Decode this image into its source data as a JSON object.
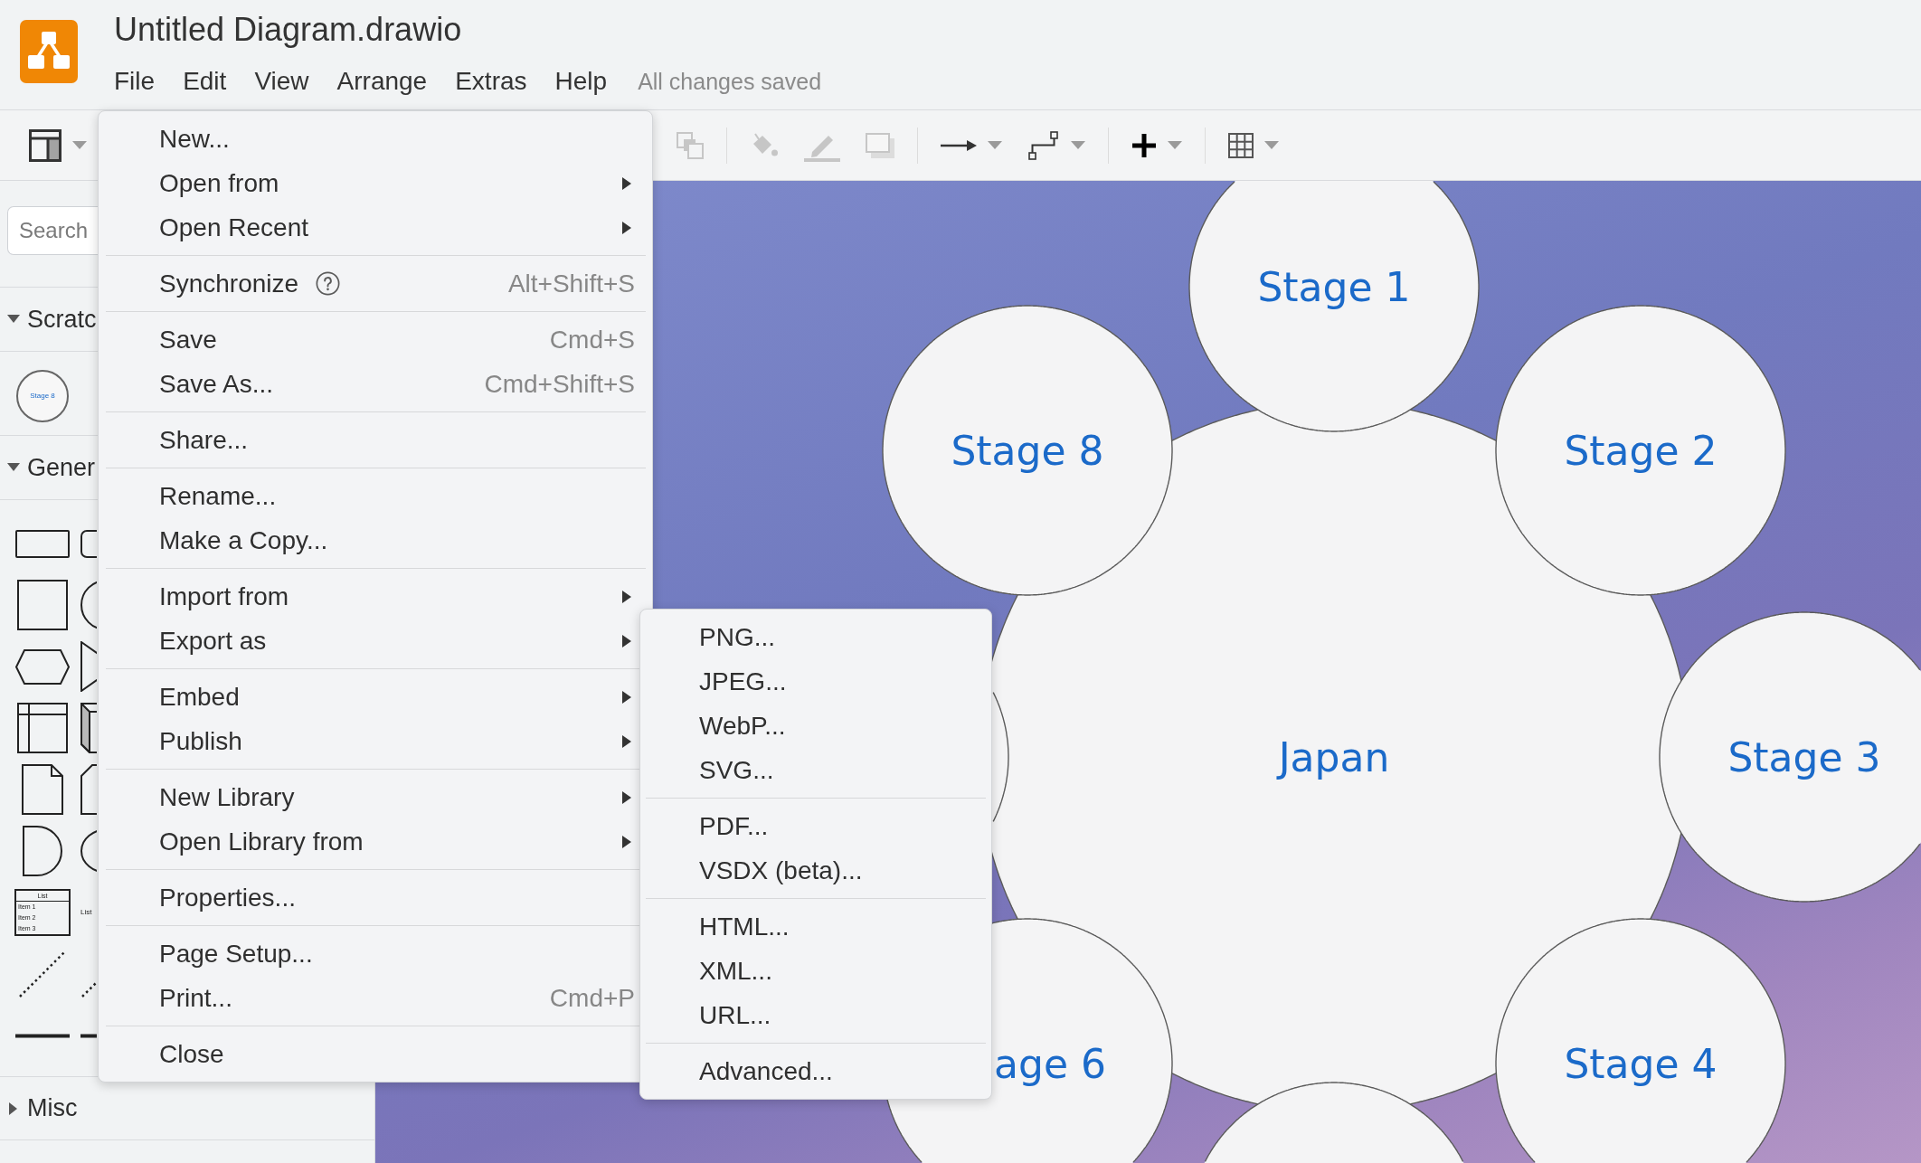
{
  "app": {
    "title": "Untitled Diagram.drawio",
    "status": "All changes saved"
  },
  "menubar": [
    "File",
    "Edit",
    "View",
    "Arrange",
    "Extras",
    "Help"
  ],
  "toolbar": {
    "left": [
      {
        "kind": "format",
        "disabled": false,
        "dropdown": true
      }
    ],
    "groups": [
      [
        {
          "kind": "arrange",
          "disabled": true
        }
      ],
      [
        {
          "kind": "fill",
          "disabled": true
        },
        {
          "kind": "line",
          "disabled": true
        },
        {
          "kind": "shadow",
          "disabled": true
        }
      ],
      [
        {
          "kind": "connection",
          "disabled": false,
          "dropdown": true
        },
        {
          "kind": "waypoint",
          "disabled": false,
          "dropdown": true
        }
      ],
      [
        {
          "kind": "insert",
          "disabled": false,
          "dropdown": true
        }
      ],
      [
        {
          "kind": "table",
          "disabled": false,
          "dropdown": true
        }
      ]
    ]
  },
  "sidebar": {
    "search": {
      "placeholder": "Search"
    },
    "sections": [
      {
        "title": "Scratc",
        "expanded": true,
        "shapes": [
          {
            "kind": "circle",
            "label": "Stage 8"
          }
        ]
      },
      {
        "title": "Gener",
        "expanded": true,
        "shapes": [
          {
            "kind": "rectangle"
          },
          {
            "kind": "rounded-rectangle"
          },
          {
            "kind": "square"
          },
          {
            "kind": "circle"
          },
          {
            "kind": "hexagon"
          },
          {
            "kind": "triangle"
          },
          {
            "kind": "storage"
          },
          {
            "kind": "cube"
          },
          {
            "kind": "document"
          },
          {
            "kind": "card"
          },
          {
            "kind": "half-round"
          },
          {
            "kind": "ellipse"
          },
          {
            "kind": "list",
            "title": "List",
            "rows": [
              "Item 1",
              "Item 2",
              "Item 3"
            ]
          },
          {
            "kind": "text",
            "label": "List"
          },
          {
            "kind": "dotted-line"
          },
          {
            "kind": "dotted-line"
          },
          {
            "kind": "line"
          },
          {
            "kind": "line"
          }
        ]
      },
      {
        "title": "Misc",
        "expanded": false
      }
    ]
  },
  "file_menu": {
    "groups": [
      [
        {
          "label": "New...",
          "submenu": false
        },
        {
          "label": "Open from",
          "submenu": true
        },
        {
          "label": "Open Recent",
          "submenu": true
        }
      ],
      [
        {
          "label": "Synchronize",
          "submenu": false,
          "help": true,
          "shortcut": "Alt+Shift+S"
        }
      ],
      [
        {
          "label": "Save",
          "submenu": false,
          "shortcut": "Cmd+S"
        },
        {
          "label": "Save As...",
          "submenu": false,
          "shortcut": "Cmd+Shift+S"
        }
      ],
      [
        {
          "label": "Share...",
          "submenu": false
        }
      ],
      [
        {
          "label": "Rename...",
          "submenu": false
        },
        {
          "label": "Make a Copy...",
          "submenu": false
        }
      ],
      [
        {
          "label": "Import from",
          "submenu": true
        },
        {
          "label": "Export as",
          "submenu": true
        }
      ],
      [
        {
          "label": "Embed",
          "submenu": true
        },
        {
          "label": "Publish",
          "submenu": true
        }
      ],
      [
        {
          "label": "New Library",
          "submenu": true
        },
        {
          "label": "Open Library from",
          "submenu": true
        }
      ],
      [
        {
          "label": "Properties...",
          "submenu": false
        }
      ],
      [
        {
          "label": "Page Setup...",
          "submenu": false
        },
        {
          "label": "Print...",
          "submenu": false,
          "shortcut": "Cmd+P"
        }
      ],
      [
        {
          "label": "Close",
          "submenu": false
        }
      ]
    ]
  },
  "export_submenu": {
    "groups": [
      [
        "PNG...",
        "JPEG...",
        "WebP...",
        "SVG..."
      ],
      [
        "PDF...",
        "VSDX (beta)..."
      ],
      [
        "HTML...",
        "XML...",
        "URL..."
      ],
      [
        "Advanced..."
      ]
    ]
  },
  "diagram": {
    "hub": {
      "kind": "circle",
      "label": "Japan"
    },
    "nodes": [
      {
        "kind": "circle",
        "label": "Stage 1"
      },
      {
        "kind": "circle",
        "label": "Stage 2"
      },
      {
        "kind": "circle",
        "label": "Stage 3"
      },
      {
        "kind": "circle",
        "label": "Stage 4"
      },
      {
        "kind": "circle"
      },
      {
        "kind": "circle",
        "label": "age 6"
      },
      {
        "kind": "circle"
      },
      {
        "kind": "circle",
        "label": "Stage 8"
      }
    ]
  }
}
